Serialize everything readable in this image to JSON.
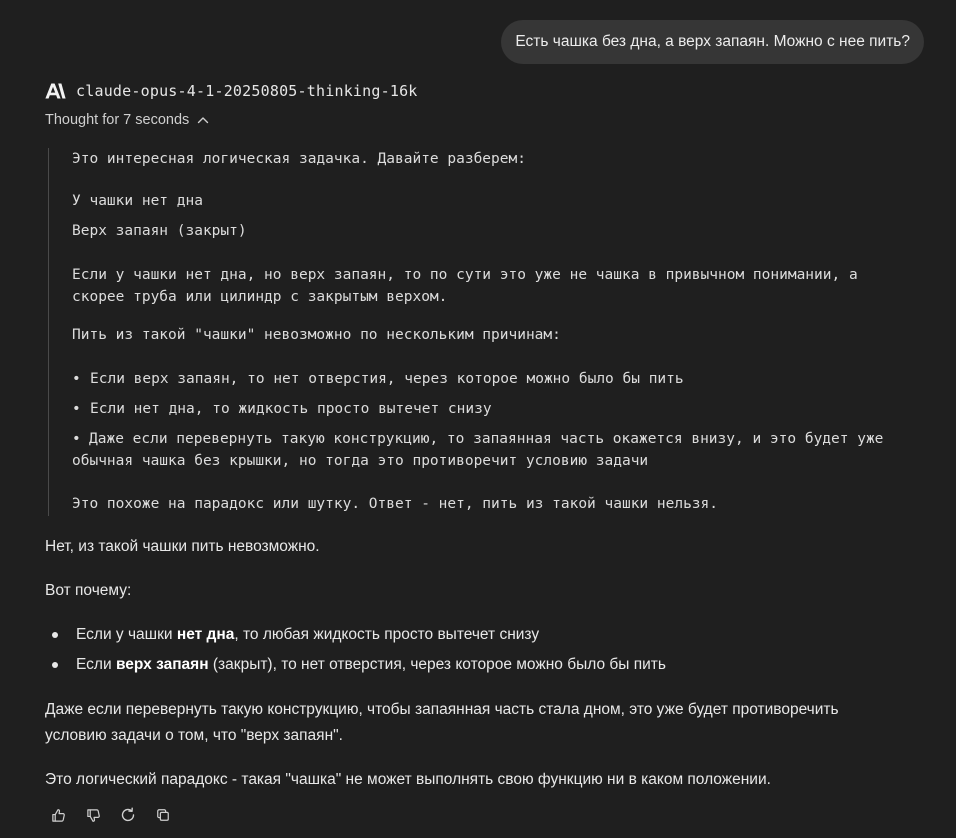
{
  "user_message": "Есть чашка без дна, а верх запаян. Можно с нее пить?",
  "model": {
    "name": "claude-opus-4-1-20250805-thinking-16k"
  },
  "thought": {
    "toggle_label": "Thought for 7 seconds",
    "lines": [
      "Это интересная логическая задачка. Давайте разберем:",
      "У чашки нет дна",
      "Верх запаян (закрыт)",
      "Если у чашки нет дна, но верх запаян, то по сути это уже не чашка в привычном понимании, а",
      "скорее труба или цилиндр с закрытым верхом.",
      "Пить из такой \"чашки\" невозможно по нескольким причинам:",
      "Если верх запаян, то нет отверстия, через которое можно было бы пить",
      "Если нет дна, то жидкость просто вытечет снизу",
      "Даже если перевернуть такую конструкцию, то запаянная часть окажется внизу, и это будет уже",
      "обычная чашка без крышки, но тогда это противоречит условию задачи",
      "Это похоже на парадокс или шутку. Ответ - нет, пить из такой чашки нельзя."
    ]
  },
  "answer": {
    "p1": "Нет, из такой чашки пить невозможно.",
    "p2": "Вот почему:",
    "b1_pre": "Если у чашки ",
    "b1_bold": "нет дна",
    "b1_post": ", то любая жидкость просто вытечет снизу",
    "b2_pre": "Если ",
    "b2_bold": "верх запаян",
    "b2_post": " (закрыт), то нет отверстия, через которое можно было бы пить",
    "p3_line1": "Даже если перевернуть такую конструкцию, чтобы запаянная часть стала дном, это уже будет противоречить",
    "p3_line2": "условию задачи о том, что \"верх запаян\".",
    "p4": "Это логический парадокс - такая \"чашка\" не может выполнять свою функцию ни в каком положении."
  },
  "actions": {
    "icons": [
      "thumbs-up-icon",
      "thumbs-down-icon",
      "refresh-icon",
      "copy-icon"
    ]
  },
  "colors": {
    "background": "#1f1f1f",
    "bubble": "#363636",
    "text": "#e6e6e6"
  }
}
